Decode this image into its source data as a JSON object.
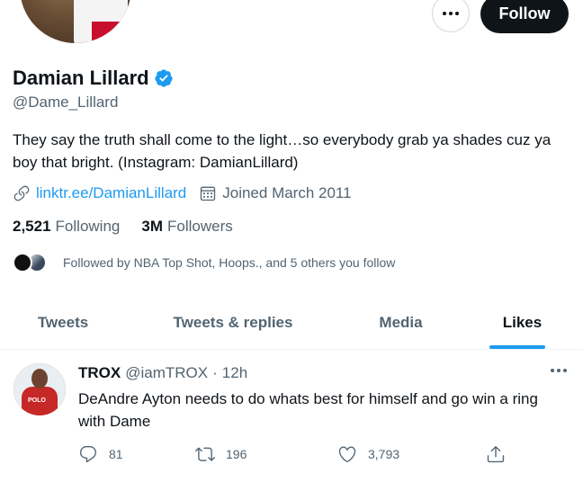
{
  "header": {
    "more_label": "More",
    "follow_label": "Follow"
  },
  "profile": {
    "name": "Damian Lillard",
    "handle": "@Dame_Lillard",
    "bio": "They say the truth shall come to the light…so everybody grab ya shades cuz ya boy that bright. (Instagram: DamianLillard)",
    "link": "linktr.ee/DamianLillard",
    "joined": "Joined March 2011",
    "following_count": "2,521",
    "following_label": "Following",
    "followers_count": "3M",
    "followers_label": "Followers",
    "followed_by": "Followed by NBA Top Shot, Hoops., and 5 others you follow"
  },
  "tabs": [
    {
      "label": "Tweets"
    },
    {
      "label": "Tweets & replies"
    },
    {
      "label": "Media"
    },
    {
      "label": "Likes",
      "active": true
    }
  ],
  "tweet": {
    "name": "TROX",
    "handle": "@iamTROX",
    "separator": "·",
    "time": "12h",
    "text": "DeAndre Ayton needs to do whats best for himself and go win a ring with Dame",
    "replies": "81",
    "retweets": "196",
    "likes": "3,793",
    "avatar_text": "POLO"
  },
  "colors": {
    "accent": "#1d9bf0",
    "text": "#0f1419",
    "muted": "#536471"
  }
}
